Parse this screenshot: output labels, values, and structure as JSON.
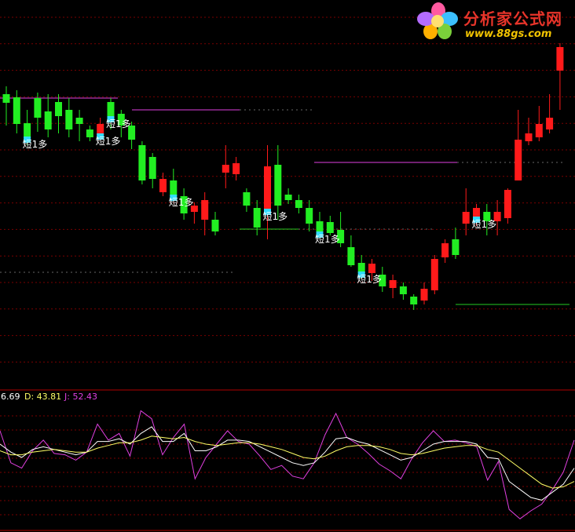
{
  "logo": {
    "name_cn": "分析家公式网",
    "url": "www.88gs.com"
  },
  "indicator": {
    "k_label": "6.69",
    "d_label": "D: 43.81",
    "j_label": "J: 52.43",
    "colors": {
      "k": "#ffffff",
      "d": "#ffff66",
      "j": "#e040e0"
    }
  },
  "signal_text": "短1多",
  "colors": {
    "up": "#ff1a1a",
    "down": "#22ee22",
    "cyan": "#33ddff",
    "grid": "#7a0000",
    "magenta_line": "#e040e0",
    "green_line": "#22cc22"
  },
  "chart_data": [
    {
      "type": "candlestick",
      "candles": [
        {
          "o": 131,
          "c": 120,
          "h": 110,
          "l": 160,
          "col": "down"
        },
        {
          "o": 124,
          "c": 158,
          "h": 115,
          "l": 170,
          "col": "down"
        },
        {
          "o": 157,
          "c": 176,
          "h": 140,
          "l": 185,
          "col": "down"
        },
        {
          "o": 150,
          "c": 125,
          "h": 118,
          "l": 168,
          "col": "down"
        },
        {
          "o": 142,
          "c": 165,
          "h": 120,
          "l": 175,
          "col": "down"
        },
        {
          "o": 148,
          "c": 130,
          "h": 120,
          "l": 170,
          "col": "down"
        },
        {
          "o": 140,
          "c": 165,
          "h": 125,
          "l": 175,
          "col": "down"
        },
        {
          "o": 150,
          "c": 158,
          "h": 140,
          "l": 180,
          "col": "down"
        },
        {
          "o": 165,
          "c": 175,
          "h": 160,
          "l": 180,
          "col": "down"
        },
        {
          "o": 158,
          "c": 172,
          "h": 150,
          "l": 178,
          "col": "up"
        },
        {
          "o": 150,
          "c": 130,
          "h": 125,
          "l": 165,
          "col": "down"
        },
        {
          "o": 145,
          "c": 160,
          "h": 140,
          "l": 175,
          "col": "down"
        },
        {
          "o": 160,
          "c": 178,
          "h": 155,
          "l": 190,
          "col": "down"
        },
        {
          "o": 185,
          "c": 230,
          "h": 180,
          "l": 235,
          "col": "down"
        },
        {
          "o": 200,
          "c": 228,
          "h": 195,
          "l": 240,
          "col": "down"
        },
        {
          "o": 228,
          "c": 245,
          "h": 220,
          "l": 250,
          "col": "up"
        },
        {
          "o": 230,
          "c": 250,
          "h": 215,
          "l": 255,
          "col": "down"
        },
        {
          "o": 250,
          "c": 272,
          "h": 240,
          "l": 280,
          "col": "down"
        },
        {
          "o": 262,
          "c": 270,
          "h": 258,
          "l": 285,
          "col": "up"
        },
        {
          "o": 255,
          "c": 280,
          "h": 245,
          "l": 300,
          "col": "up"
        },
        {
          "o": 280,
          "c": 295,
          "h": 270,
          "l": 300,
          "col": "down"
        },
        {
          "o": 220,
          "c": 210,
          "h": 185,
          "l": 240,
          "col": "up"
        },
        {
          "o": 222,
          "c": 208,
          "h": 200,
          "l": 230,
          "col": "up"
        },
        {
          "o": 245,
          "c": 262,
          "h": 240,
          "l": 270,
          "col": "down"
        },
        {
          "o": 265,
          "c": 290,
          "h": 255,
          "l": 300,
          "col": "down"
        },
        {
          "o": 212,
          "c": 268,
          "h": 185,
          "l": 305,
          "col": "up"
        },
        {
          "o": 210,
          "c": 262,
          "h": 185,
          "l": 280,
          "col": "down"
        },
        {
          "o": 248,
          "c": 255,
          "h": 240,
          "l": 260,
          "col": "down"
        },
        {
          "o": 255,
          "c": 265,
          "h": 248,
          "l": 272,
          "col": "down"
        },
        {
          "o": 265,
          "c": 285,
          "h": 255,
          "l": 295,
          "col": "down"
        },
        {
          "o": 282,
          "c": 297,
          "h": 270,
          "l": 300,
          "col": "down"
        },
        {
          "o": 283,
          "c": 297,
          "h": 275,
          "l": 300,
          "col": "down"
        },
        {
          "o": 293,
          "c": 310,
          "h": 270,
          "l": 315,
          "col": "down"
        },
        {
          "o": 315,
          "c": 338,
          "h": 300,
          "l": 340,
          "col": "down"
        },
        {
          "o": 335,
          "c": 348,
          "h": 325,
          "l": 355,
          "col": "down"
        },
        {
          "o": 336,
          "c": 348,
          "h": 330,
          "l": 358,
          "col": "up"
        },
        {
          "o": 350,
          "c": 365,
          "h": 340,
          "l": 372,
          "col": "down"
        },
        {
          "o": 357,
          "c": 367,
          "h": 350,
          "l": 380,
          "col": "up"
        },
        {
          "o": 365,
          "c": 375,
          "h": 360,
          "l": 382,
          "col": "down"
        },
        {
          "o": 378,
          "c": 388,
          "h": 375,
          "l": 395,
          "col": "down"
        },
        {
          "o": 383,
          "c": 368,
          "h": 360,
          "l": 388,
          "col": "up"
        },
        {
          "o": 370,
          "c": 330,
          "h": 325,
          "l": 375,
          "col": "up"
        },
        {
          "o": 328,
          "c": 310,
          "h": 305,
          "l": 335,
          "col": "up"
        },
        {
          "o": 305,
          "c": 325,
          "h": 290,
          "l": 330,
          "col": "down"
        },
        {
          "o": 285,
          "c": 270,
          "h": 240,
          "l": 300,
          "col": "up"
        },
        {
          "o": 265,
          "c": 278,
          "h": 260,
          "l": 288,
          "col": "up"
        },
        {
          "o": 270,
          "c": 282,
          "h": 260,
          "l": 300,
          "col": "down"
        },
        {
          "o": 282,
          "c": 270,
          "h": 255,
          "l": 300,
          "col": "up"
        },
        {
          "o": 242,
          "c": 278,
          "h": 240,
          "l": 285,
          "col": "up"
        },
        {
          "o": 230,
          "c": 178,
          "h": 140,
          "l": 230,
          "col": "up"
        },
        {
          "o": 170,
          "c": 180,
          "h": 150,
          "l": 185,
          "col": "up"
        },
        {
          "o": 175,
          "c": 158,
          "h": 135,
          "l": 180,
          "col": "up"
        },
        {
          "o": 165,
          "c": 150,
          "h": 120,
          "l": 170,
          "col": "up"
        },
        {
          "o": 90,
          "c": 60,
          "h": 55,
          "l": 140,
          "col": "up"
        }
      ],
      "signals": [
        {
          "i": 2,
          "text": "短1多"
        },
        {
          "i": 9,
          "text": "短1多"
        },
        {
          "i": 10,
          "text": "短1多"
        },
        {
          "i": 16,
          "text": "短1多"
        },
        {
          "i": 25,
          "text": "短1多"
        },
        {
          "i": 30,
          "text": "短1多"
        },
        {
          "i": 34,
          "text": "短1多"
        },
        {
          "i": 45,
          "text": "短1多"
        }
      ]
    },
    {
      "type": "line",
      "series": [
        {
          "name": "J",
          "values": [
            100,
            76,
            72,
            85,
            93,
            83,
            82,
            78,
            84,
            105,
            93,
            98,
            81,
            115,
            109,
            82,
            95,
            105,
            64,
            80,
            90,
            100,
            92,
            90,
            81,
            71,
            74,
            66,
            64,
            76,
            97,
            113,
            95,
            90,
            83,
            75,
            70,
            64,
            79,
            91,
            100,
            92,
            93,
            91,
            88,
            63,
            77,
            41,
            34,
            40,
            45,
            56,
            69,
            93
          ]
        },
        {
          "name": "K",
          "values": [
            90,
            84,
            80,
            86,
            88,
            86,
            84,
            82,
            84,
            92,
            92,
            94,
            90,
            98,
            103,
            92,
            92,
            98,
            85,
            85,
            88,
            93,
            93,
            92,
            88,
            84,
            80,
            76,
            74,
            76,
            84,
            94,
            95,
            92,
            90,
            86,
            82,
            78,
            80,
            85,
            90,
            92,
            92,
            92,
            90,
            80,
            79,
            62,
            56,
            50,
            48,
            54,
            60,
            72
          ]
        },
        {
          "name": "D",
          "values": [
            85,
            82,
            82,
            84,
            85,
            86,
            85,
            84,
            84,
            87,
            89,
            91,
            91,
            93,
            96,
            95,
            94,
            95,
            92,
            90,
            89,
            90,
            91,
            91,
            90,
            88,
            86,
            83,
            80,
            79,
            81,
            85,
            88,
            89,
            89,
            88,
            86,
            83,
            82,
            83,
            85,
            87,
            88,
            89,
            89,
            86,
            84,
            78,
            72,
            66,
            60,
            57,
            58,
            62
          ]
        }
      ]
    }
  ]
}
